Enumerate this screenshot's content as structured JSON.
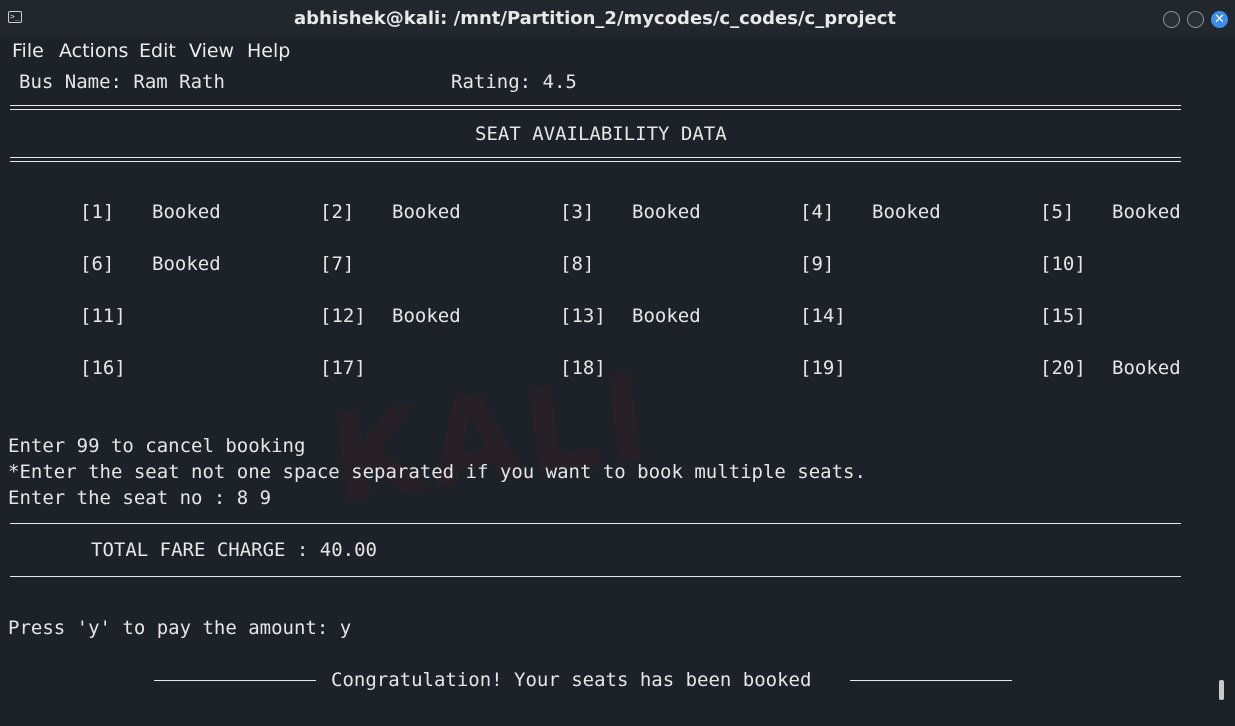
{
  "window": {
    "title": "abhishek@kali: /mnt/Partition_2/mycodes/c_codes/c_project",
    "icons": [
      "terminal-icon",
      "minimize-icon",
      "maximize-icon",
      "close-icon"
    ],
    "accent": "#3d8ee8"
  },
  "menu": [
    "File",
    "Actions",
    "Edit",
    "View",
    "Help"
  ],
  "terminal": {
    "bus_name": "Bus Name: Ram Rath",
    "rating": "Rating: 4.5",
    "heading": "SEAT AVAILABILITY DATA",
    "seats": [
      [
        {
          "num": "[1]",
          "status": "Booked"
        },
        {
          "num": "[2]",
          "status": "Booked"
        },
        {
          "num": "[3]",
          "status": "Booked"
        },
        {
          "num": "[4]",
          "status": "Booked"
        },
        {
          "num": "[5]",
          "status": "Booked"
        }
      ],
      [
        {
          "num": "[6]",
          "status": "Booked"
        },
        {
          "num": "[7]",
          "status": ""
        },
        {
          "num": "[8]",
          "status": ""
        },
        {
          "num": "[9]",
          "status": ""
        },
        {
          "num": "[10]",
          "status": ""
        }
      ],
      [
        {
          "num": "[11]",
          "status": ""
        },
        {
          "num": "[12]",
          "status": "Booked"
        },
        {
          "num": "[13]",
          "status": "Booked"
        },
        {
          "num": "[14]",
          "status": ""
        },
        {
          "num": "[15]",
          "status": ""
        }
      ],
      [
        {
          "num": "[16]",
          "status": ""
        },
        {
          "num": "[17]",
          "status": ""
        },
        {
          "num": "[18]",
          "status": ""
        },
        {
          "num": "[19]",
          "status": ""
        },
        {
          "num": "[20]",
          "status": "Booked"
        }
      ]
    ],
    "cancel_hint": "Enter 99 to cancel booking",
    "multi_hint": "*Enter the seat not one space separated if you want to book multiple seats.",
    "seat_prompt": "Enter the seat no : 8 9",
    "fare": "TOTAL FARE CHARGE : 40.00",
    "pay_prompt": "Press 'y' to pay the amount: y",
    "confirmation": "Congratulation! Your seats has been booked"
  }
}
